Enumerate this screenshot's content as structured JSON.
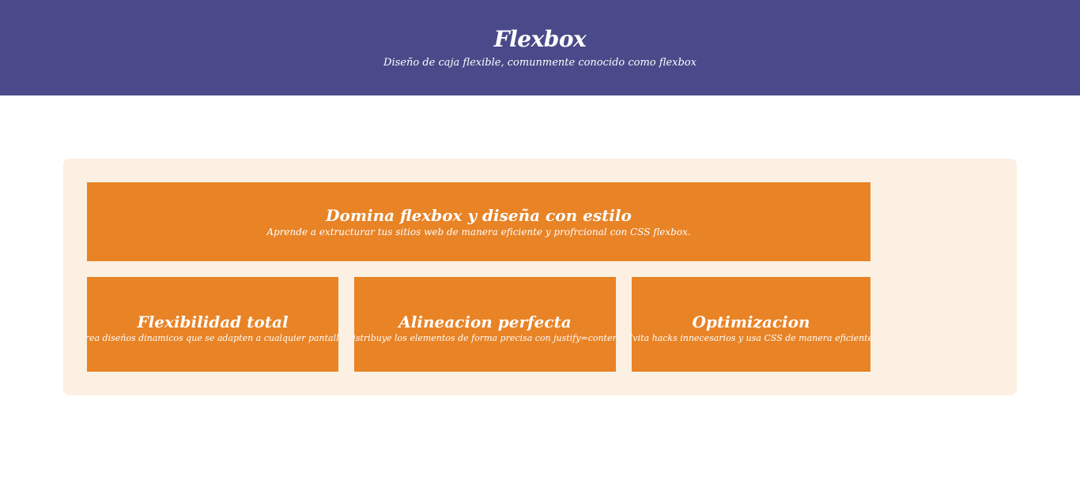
{
  "header": {
    "title": "Flexbox",
    "subtitle": "Diseño de caja flexible, comunmente conocido como flexbox"
  },
  "hero": {
    "title": "Domina flexbox y diseña con estilo",
    "text": "Aprende a extructurar tus sitios web de manera eficiente y profrcional con CSS flexbox."
  },
  "features": [
    {
      "title": "Flexibilidad total",
      "text": "Crea diseños dinamicos que se adapten a cualquier pantalla."
    },
    {
      "title": "Alineacion perfecta",
      "text": "Distribuye los elementos de forma precisa con justify=content."
    },
    {
      "title": "Optimizacion",
      "text": "Evita hacks innecesarios y usa CSS de manera eficiente."
    }
  ],
  "colors": {
    "header_bg": "#4a4a8a",
    "panel_bg": "#fbf0e2",
    "card_bg": "#e88326",
    "text": "#ffffff"
  }
}
